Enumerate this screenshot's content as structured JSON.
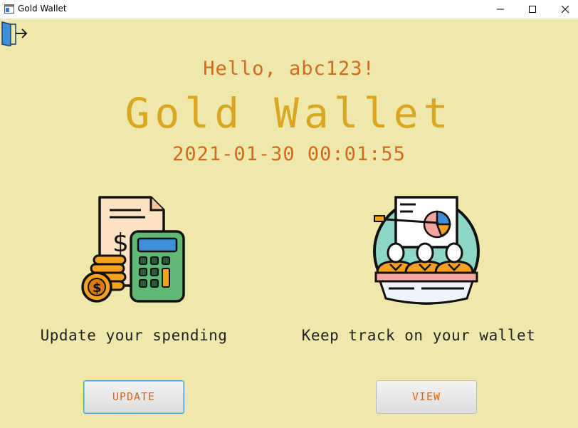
{
  "window": {
    "title": "Gold Wallet",
    "icon": "app-window-icon",
    "controls": [
      "minimize-icon",
      "maximize-icon",
      "close-icon"
    ]
  },
  "header": {
    "logout_icon": "logout-door-icon",
    "greeting": "Hello, abc123!",
    "app_title": "Gold Wallet",
    "datetime": "2021-01-30 00:01:55"
  },
  "cards": [
    {
      "icon": "calculator-coins-icon",
      "caption": "Update your spending",
      "button_label": "UPDATE"
    },
    {
      "icon": "presentation-team-icon",
      "caption": "Keep track on your wallet",
      "button_label": "VIEW"
    }
  ],
  "colors": {
    "background": "#eee8aa",
    "greeting": "#d2691e",
    "title": "#daa520",
    "button_text": "#d2691e"
  }
}
